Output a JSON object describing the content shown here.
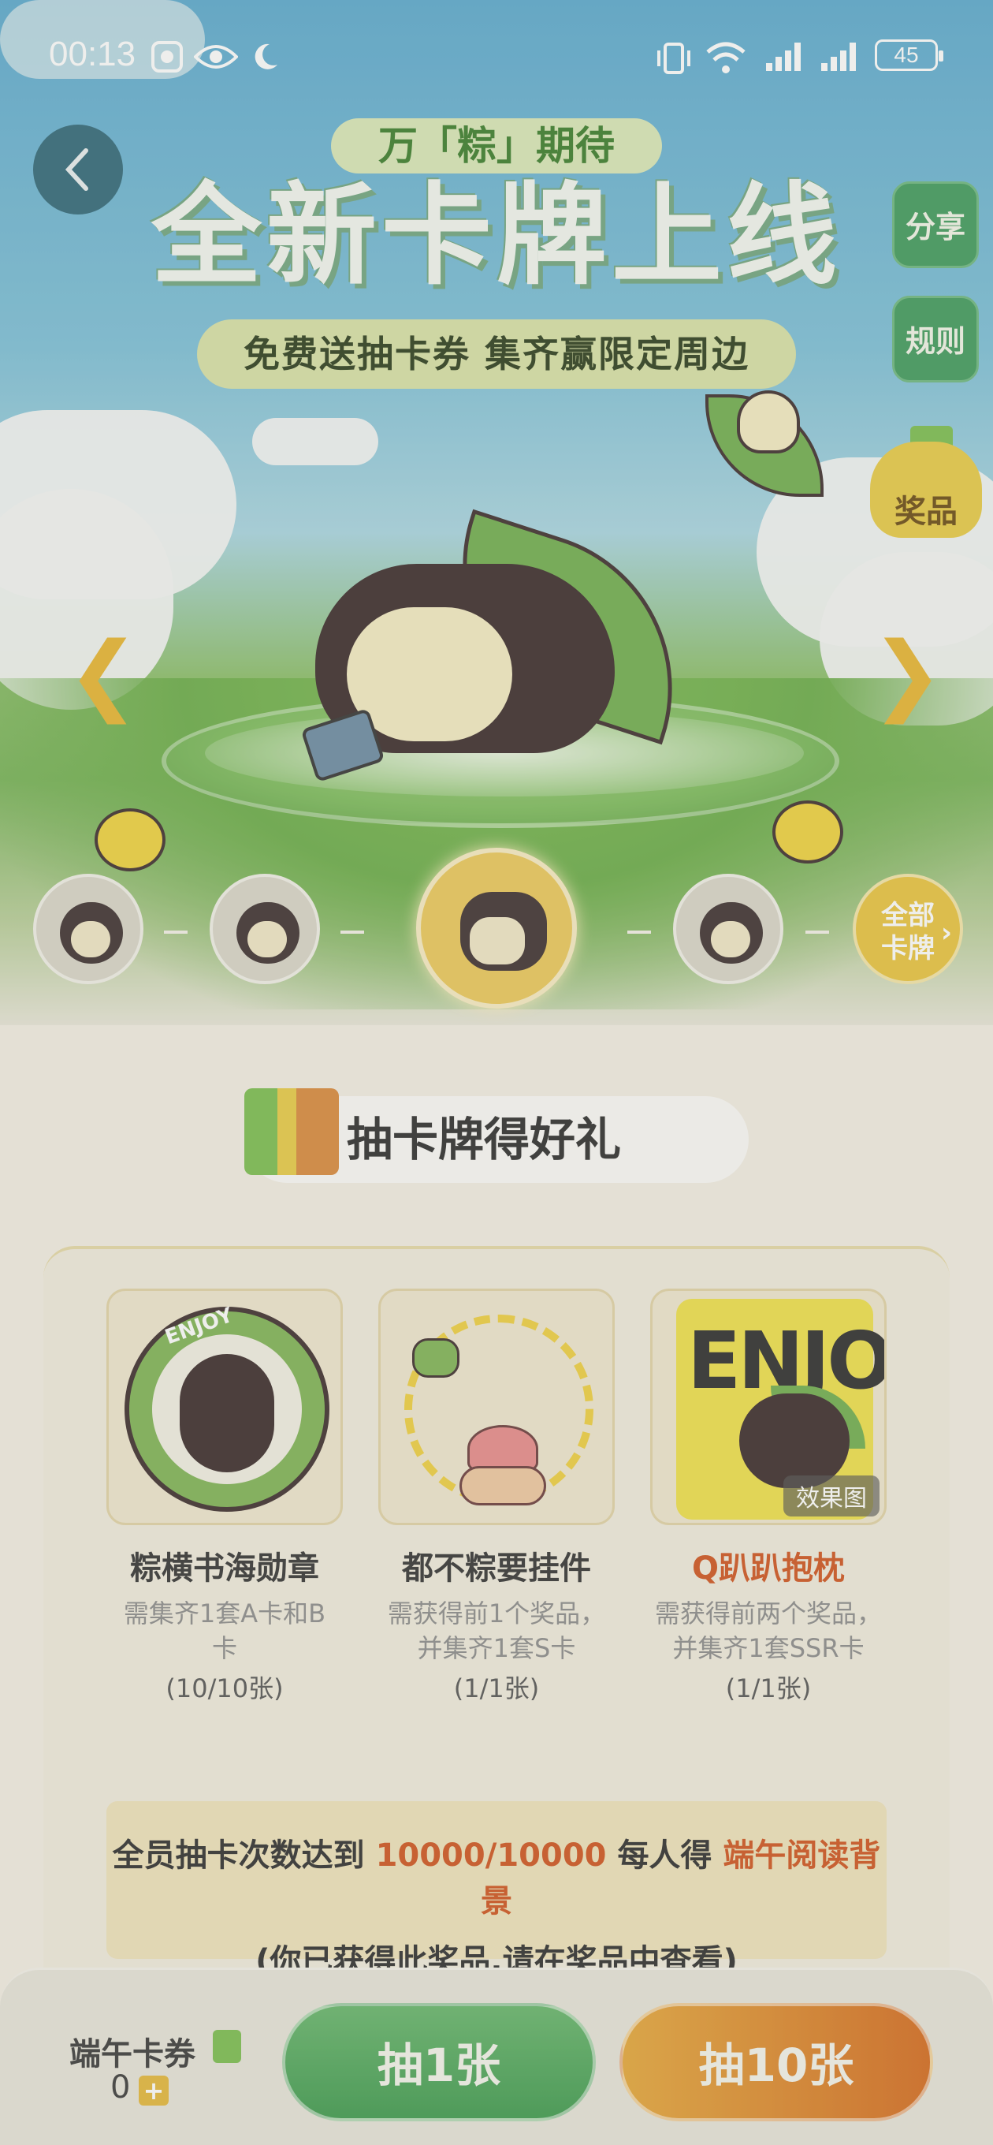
{
  "status_bar": {
    "time": "00:13",
    "battery": "45",
    "icons": [
      "record-icon",
      "eye-icon",
      "moon-icon",
      "vibrate-icon",
      "wifi-icon",
      "signal-icon",
      "signal-icon",
      "battery-icon"
    ]
  },
  "header": {
    "back_icon": "chevron-left-icon",
    "tagline": "万「粽」期待",
    "title": "全新卡牌上线",
    "banner": "免费送抽卡券  集齐赢限定周边",
    "share_label": "分享",
    "rules_label": "规则",
    "prizes_label": "奖品"
  },
  "hero": {
    "prev_icon": "chevron-left-icon",
    "next_icon": "chevron-right-icon"
  },
  "card_selector": {
    "thumbs": [
      "card-thumb-1",
      "card-thumb-2",
      "card-thumb-selected",
      "card-thumb-4"
    ],
    "all_cards_label_line1": "全部",
    "all_cards_label_line2": "卡牌"
  },
  "section": {
    "title": "抽卡牌得好礼"
  },
  "prizes": [
    {
      "name": "粽横书海勋章",
      "desc": "需集齐1套A卡和B卡",
      "count": "(10/10张)",
      "badge_text": "ENJOY"
    },
    {
      "name": "都不粽要挂件",
      "desc": "需获得前1个奖品，并集齐1套S卡",
      "count": "(1/1张)"
    },
    {
      "name": "Q趴趴抱枕",
      "desc": "需获得前两个奖品，并集齐1套SSR卡",
      "count": "(1/1张)",
      "effect_tag": "效果图",
      "pillow_text": "ENJOY"
    }
  ],
  "goal": {
    "prefix": "全员抽卡次数达到",
    "progress": "10000/10000",
    "middle": "每人得",
    "reward": "端午阅读背景",
    "note": "(你已获得此奖品,请在奖品中查看)"
  },
  "bottom": {
    "ticket_label": "端午卡券",
    "ticket_count": "0",
    "plus": "+",
    "draw_one": "抽1张",
    "draw_ten": "抽10张"
  },
  "colors": {
    "accent_orange": "#d0531e",
    "green_button": "#3d9a4d",
    "orange_button": "#d56a1d"
  }
}
